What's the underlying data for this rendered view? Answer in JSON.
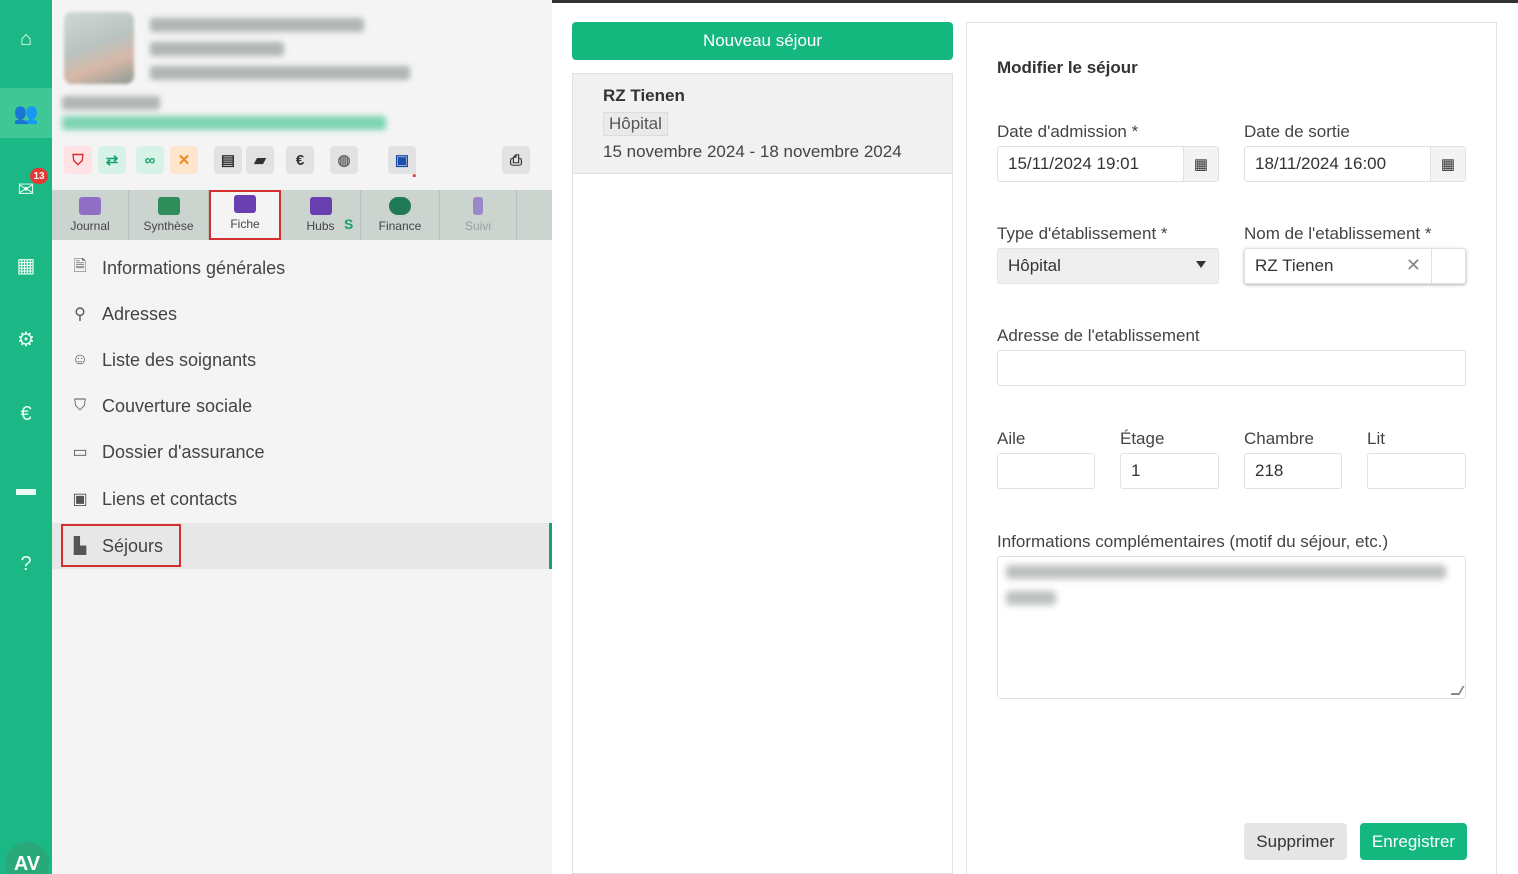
{
  "rail": {
    "items": [
      {
        "name": "home-icon",
        "glyph": "⌂"
      },
      {
        "name": "patients-icon",
        "glyph": "👥"
      },
      {
        "name": "mail-icon",
        "glyph": "✉"
      },
      {
        "name": "calendar-icon",
        "glyph": "▦"
      },
      {
        "name": "settings-icon",
        "glyph": "⚙"
      },
      {
        "name": "euro-icon",
        "glyph": "€"
      },
      {
        "name": "briefcase-icon",
        "glyph": "▬"
      },
      {
        "name": "help-icon",
        "glyph": "?"
      }
    ],
    "mail_badge": "13",
    "avatar_initials": "AV"
  },
  "toolbar": {
    "euro": "€",
    "alert": "!"
  },
  "module_tabs": [
    {
      "label": "Journal",
      "color": "#8e6fc5"
    },
    {
      "label": "Synthèse",
      "color": "#2f8c5b"
    },
    {
      "label": "Fiche",
      "color": "#6a3fb0"
    },
    {
      "label": "Hubs",
      "color": "#6a3fb0"
    },
    {
      "label": "Finance",
      "color": "#1f7a55"
    },
    {
      "label": "Suivi",
      "color": "#9a88c9"
    }
  ],
  "hubs_badge": "S",
  "menu": [
    {
      "label": "Informations générales",
      "icon": "🗎"
    },
    {
      "label": "Adresses",
      "icon": "⚲"
    },
    {
      "label": "Liste des soignants",
      "icon": "☺"
    },
    {
      "label": "Couverture sociale",
      "icon": "⛉"
    },
    {
      "label": "Dossier d'assurance",
      "icon": "▭"
    },
    {
      "label": "Liens et contacts",
      "icon": "▣"
    },
    {
      "label": "Séjours",
      "icon": "▙"
    }
  ],
  "stays": {
    "new_button": "Nouveau séjour",
    "items": [
      {
        "title": "RZ Tienen",
        "type": "Hôpital",
        "dates": "15 novembre 2024  -  18 novembre 2024"
      }
    ]
  },
  "form": {
    "title": "Modifier le séjour",
    "admission_label": "Date d'admission *",
    "admission_value": "15/11/2024 19:01",
    "exit_label": "Date de sortie",
    "exit_value": "18/11/2024 16:00",
    "type_label": "Type d'établissement *",
    "type_value": "Hôpital",
    "name_label": "Nom de l'etablissement *",
    "name_value": "RZ Tienen",
    "address_label": "Adresse de l'etablissement",
    "address_value": "",
    "wing_label": "Aile",
    "wing_value": "",
    "floor_label": "Étage",
    "floor_value": "1",
    "room_label": "Chambre",
    "room_value": "218",
    "bed_label": "Lit",
    "bed_value": "",
    "info_label": "Informations complémentaires (motif du séjour, etc.)",
    "delete_button": "Supprimer",
    "save_button": "Enregistrer"
  },
  "colors": {
    "brand": "#1bb784",
    "primary_button": "#14b77e",
    "highlight": "#d32f2f"
  }
}
